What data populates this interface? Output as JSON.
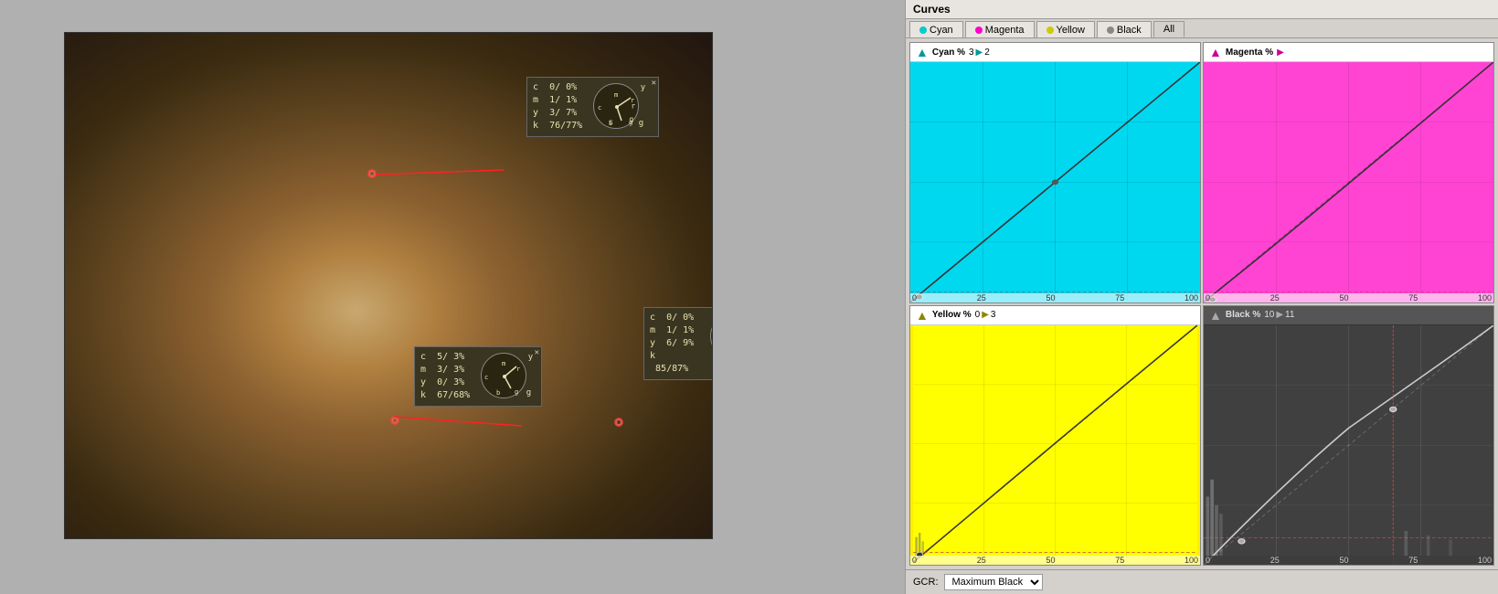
{
  "title": "Curves",
  "tabs": [
    {
      "label": "Cyan",
      "color": "#00cccc",
      "active": false
    },
    {
      "label": "Magenta",
      "color": "#ff00cc",
      "active": false
    },
    {
      "label": "Yellow",
      "color": "#cccc00",
      "active": false
    },
    {
      "label": "Black",
      "color": "#888888",
      "active": false
    },
    {
      "label": "All",
      "color": null,
      "active": true
    }
  ],
  "curves": [
    {
      "id": "cyan",
      "label": "Cyan %",
      "values": "3 ▶ 2",
      "bg": "#00d8f0",
      "arrowColor": "#00aacc"
    },
    {
      "id": "magenta",
      "label": "Magenta %",
      "values": "",
      "bg": "#ff44d4",
      "arrowColor": "#cc00aa"
    },
    {
      "id": "yellow",
      "label": "Yellow %",
      "values": "0 ▶ 3",
      "bg": "#ffff00",
      "arrowColor": "#cccc00"
    },
    {
      "id": "black",
      "label": "Black %",
      "values": "10 ▶ 11",
      "bg": "#404040",
      "arrowColor": "#666666"
    }
  ],
  "axis_labels": [
    "0",
    "25",
    "50",
    "75",
    "100"
  ],
  "popup1": {
    "c": "0/ 0%",
    "m": "1/ 1%",
    "y": "3/ 7%",
    "k": "76/77%"
  },
  "popup2": {
    "c": "5/ 3%",
    "m": "3/ 3%",
    "y": "0/ 3%",
    "k": "67/68%"
  },
  "popup3": {
    "c": "0/ 0%",
    "m": "1/ 1%",
    "y": "6/ 9%",
    "k": "85/87%"
  },
  "gcr": {
    "label": "GCR:",
    "value": "Maximum Black"
  }
}
